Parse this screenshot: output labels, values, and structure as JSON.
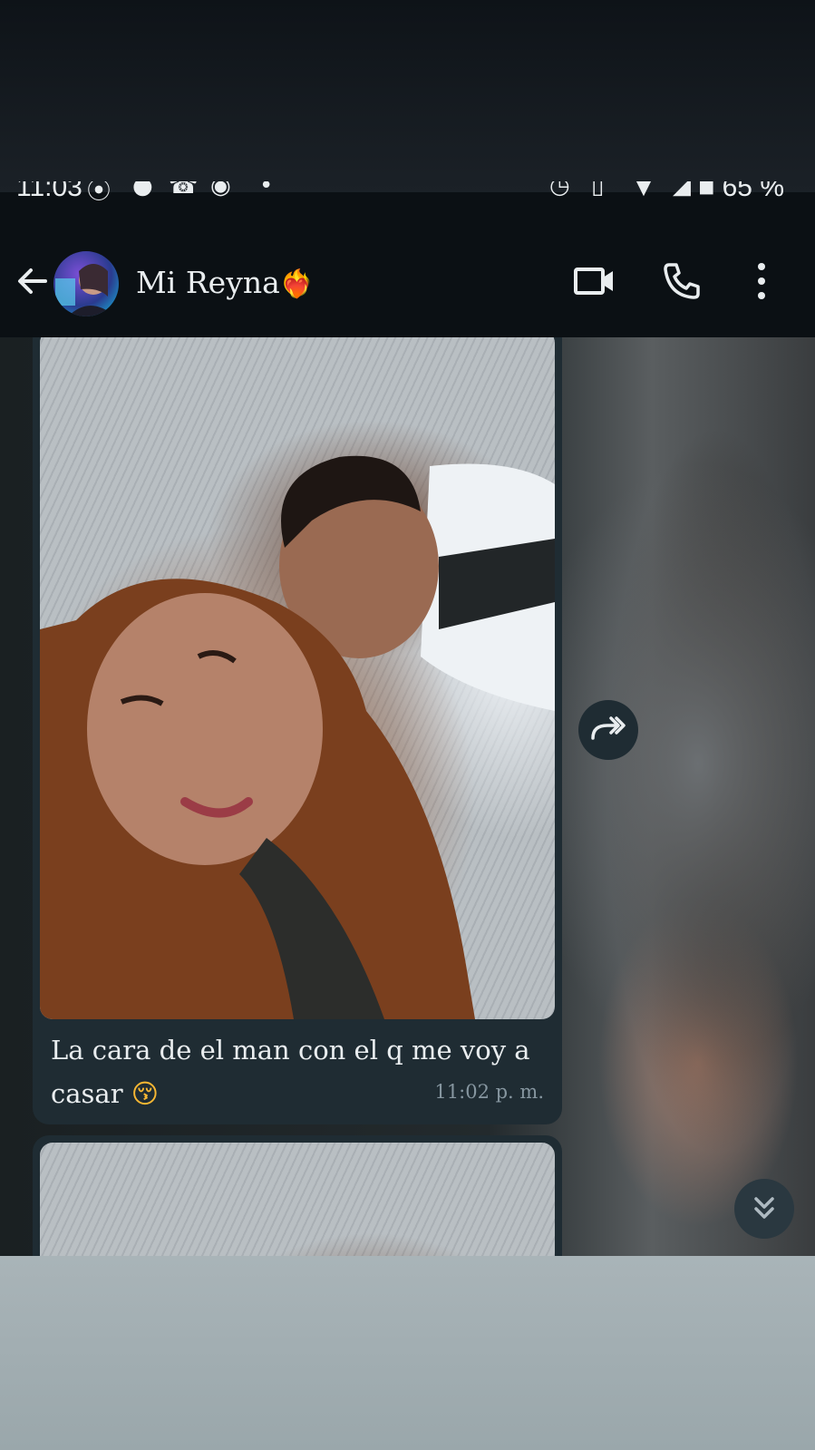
{
  "status_bar": {
    "time": "11:03",
    "battery": "65 %"
  },
  "header": {
    "contact_name": "Mi Reyna",
    "contact_emoji": "❤️‍🔥",
    "avatar_alt": "contact-photo"
  },
  "message": {
    "caption_text": "La cara de el man con el q me voy a casar",
    "caption_emoji": "😚",
    "time": "11:02 p. m."
  },
  "colors": {
    "bubble": "#1f2c33",
    "header_bg": "#0b1014",
    "text": "#e9edef",
    "muted": "#8696a0"
  },
  "icons": {
    "back": "arrow-left-icon",
    "video": "video-camera-icon",
    "call": "phone-icon",
    "menu": "more-vertical-icon",
    "forward": "forward-icon",
    "scroll_down": "chevron-double-down-icon"
  }
}
